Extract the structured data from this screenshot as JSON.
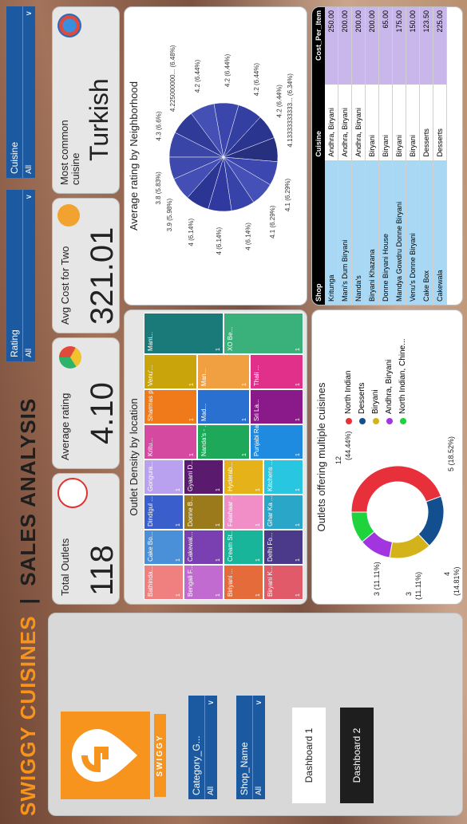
{
  "header": {
    "title_part1": "SWIGGY CUISINES",
    "separator": "|",
    "title_part2": "SALES ANALYSIS"
  },
  "logo": {
    "text": "SWIGGY"
  },
  "slicers": {
    "category": {
      "label": "Category_G...",
      "value": "All"
    },
    "shop": {
      "label": "Shop_Name",
      "value": "All"
    },
    "rating": {
      "label": "Rating",
      "value": "All"
    },
    "cuisine": {
      "label": "Cuisine",
      "value": "All"
    }
  },
  "nav": {
    "dashboard1": "Dashboard 1",
    "dashboard2": "Dashboard 2"
  },
  "kpis": {
    "total_outlets": {
      "label": "Total Outlets",
      "value": "118"
    },
    "average_rating": {
      "label": "Average rating",
      "value": "4.10"
    },
    "avg_cost": {
      "label": "Avg Cost for Two",
      "value": "321.01"
    },
    "common_cuisine": {
      "label_line1": "Most common",
      "label_line2": "cuisine",
      "value": "Turkish"
    }
  },
  "treemap": {
    "title": "Outlet Density by location",
    "cells": [
      {
        "name": "Bathinda...",
        "value": "1",
        "color": "#f08080"
      },
      {
        "name": "Bengali F...",
        "value": "1",
        "color": "#c16bd1"
      },
      {
        "name": "Biriyani ...",
        "value": "1",
        "color": "#e66b3a"
      },
      {
        "name": "Biryani K...",
        "value": "1",
        "color": "#e05a6a"
      },
      {
        "name": "Cake Bo...",
        "value": "1",
        "color": "#4a90d9"
      },
      {
        "name": "Cakewal...",
        "value": "1",
        "color": "#7a3fb0"
      },
      {
        "name": "Cream St...",
        "value": "1",
        "color": "#18b59a"
      },
      {
        "name": "Delhi Fo...",
        "value": "1",
        "color": "#4b3a8a"
      },
      {
        "name": "Dindigul ...",
        "value": "1",
        "color": "#3a5fcd"
      },
      {
        "name": "Donne B...",
        "value": "1",
        "color": "#9a7a1a"
      },
      {
        "name": "Falahaar ...",
        "value": "1",
        "color": "#f18ec8"
      },
      {
        "name": "Ghar Ka ...",
        "value": "1",
        "color": "#2aa6c9"
      },
      {
        "name": "Gongura...",
        "value": "1",
        "color": "#b9a1f0"
      },
      {
        "name": "Gyaani D...",
        "value": "1",
        "color": "#5a1a6e"
      },
      {
        "name": "Hyderab...",
        "value": "1",
        "color": "#e6b21a"
      },
      {
        "name": "Kitchens ...",
        "value": "1",
        "color": "#28c6e0"
      },
      {
        "name": "Kritu...",
        "value": "1",
        "color": "#d54aa0"
      },
      {
        "name": "Nanda's - ...",
        "value": "1",
        "color": "#1ea85a"
      },
      {
        "name": "Punjabi Ra...",
        "value": "1",
        "color": "#1e8be0"
      },
      {
        "name": "Sharmas p...",
        "value": "1",
        "color": "#f07a1a"
      },
      {
        "name": "Mad...",
        "value": "1",
        "color": "#2a70d0"
      },
      {
        "name": "Sri La...",
        "value": "1",
        "color": "#8a1a8a"
      },
      {
        "name": "Venu'...",
        "value": "1",
        "color": "#c9a40a"
      },
      {
        "name": "Man...",
        "value": "1",
        "color": "#f0a040"
      },
      {
        "name": "Thali ...",
        "value": "1",
        "color": "#e0308a"
      },
      {
        "name": "Mani...",
        "value": "1",
        "color": "#1a7a7a"
      },
      {
        "name": "XO Be...",
        "value": "1",
        "color": "#3ab07a"
      }
    ]
  },
  "pie": {
    "title": "Average rating by Neighborhood",
    "labels": [
      "4.3 (6.6%)",
      "4.225000000... (6.48%)",
      "4.2 (6.44%)",
      "4.2 (6.44%)",
      "4.2 (6.44%)",
      "4.2 (6.44%)",
      "4.13333333333... (6.34%)",
      "4.1 (6.29%)",
      "4.1 (6.29%)",
      "4 (6.14%)",
      "4 (6.14%)",
      "4 (6.14%)",
      "3.9 (5.98%)",
      "3.8 (5.83%)"
    ]
  },
  "donut": {
    "title": "Outlets offering multiple cuisines",
    "segments": [
      {
        "label": "North Indian",
        "value": 12,
        "pct": "(44.44%)",
        "color": "#e8303a"
      },
      {
        "label": "Desserts",
        "value": 5,
        "pct": "(18.52%)",
        "color": "#134f8f"
      },
      {
        "label": "Biryani",
        "value": 4,
        "pct": "(14.81%)",
        "color": "#d4b21a"
      },
      {
        "label": "Andhra, Biryani",
        "value": 3,
        "pct": "(11.11%)",
        "color": "#a335e0"
      },
      {
        "label": "North Indian, Chine...",
        "value": 3,
        "pct": "(11.11%)",
        "color": "#1fd33c"
      }
    ],
    "callouts": {
      "north": "12",
      "north_pct": "(44.44%)",
      "desserts": "5 (18.52%)",
      "biryani": "4",
      "biryani_pct": "(14.81%)",
      "andhra": "3",
      "andhra_pct": "(11.11%)",
      "nic": "3 (11.11%)"
    }
  },
  "table": {
    "headers": [
      "Shop",
      "Cuisine",
      "Cost_Per_Item"
    ],
    "rows": [
      [
        "Kritunga",
        "Andhra, Biryani",
        "250.00"
      ],
      [
        "Mani's Dum Biryani",
        "Andhra, Biryani",
        "200.00"
      ],
      [
        "Nanda's",
        "Andhra, Biryani",
        "200.00"
      ],
      [
        "Biryani Khazana",
        "Biryani",
        "200.00"
      ],
      [
        "Donne Biryani House",
        "Biryani",
        "65.00"
      ],
      [
        "Mandya Gowdru Donne Biryani",
        "Biryani",
        "175.00"
      ],
      [
        "Venu's Donne Biryani",
        "Biryani",
        "150.00"
      ],
      [
        "Cake Box",
        "Desserts",
        "123.50"
      ],
      [
        "Cakewala",
        "Desserts",
        "225.00"
      ]
    ]
  },
  "colors": {
    "orange": "#f7941d",
    "navy": "#1b5aa0",
    "panel": "#e6e6e6"
  }
}
